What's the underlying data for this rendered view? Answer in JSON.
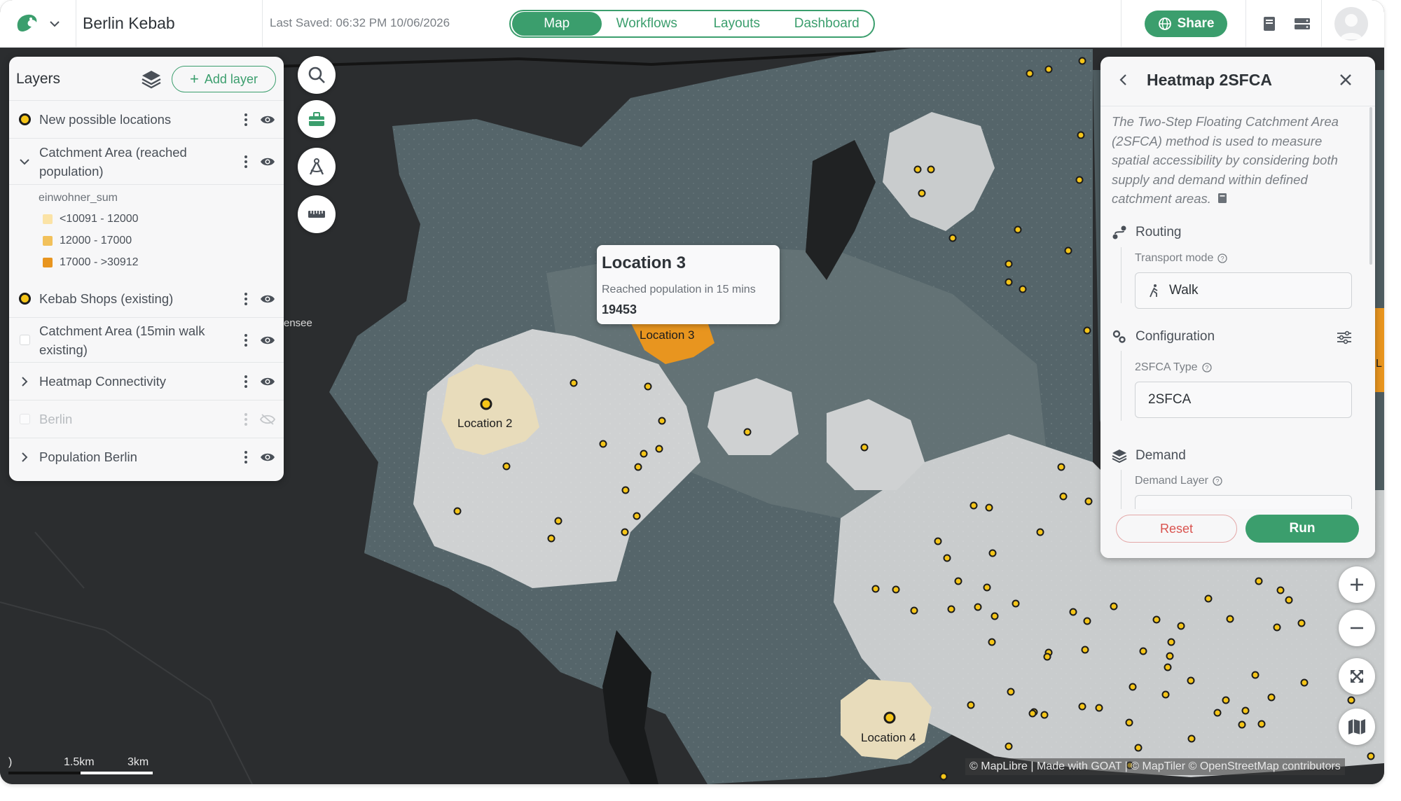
{
  "header": {
    "project_title": "Berlin Kebab",
    "last_saved": "Last Saved: 06:32 PM 10/06/2026",
    "tabs": [
      {
        "label": "Map",
        "active": true
      },
      {
        "label": "Workflows",
        "active": false
      },
      {
        "label": "Layouts",
        "active": false
      },
      {
        "label": "Dashboard",
        "active": false
      }
    ],
    "share_label": "Share",
    "accent_color": "#3b9e6d"
  },
  "layers_panel": {
    "title": "Layers",
    "add_layer_label": "Add layer",
    "layers": [
      {
        "name": "New possible locations",
        "marker": "yellow-dot",
        "visible": true
      },
      {
        "name": "Catchment Area (reached population)",
        "marker": "chevron-down",
        "visible": true
      },
      {
        "name": "Kebab Shops (existing)",
        "marker": "yellow-dot",
        "visible": true
      },
      {
        "name": "Catchment Area (15min walk existing)",
        "marker": "white-square",
        "visible": true
      },
      {
        "name": "Heatmap Connectivity",
        "marker": "chevron-right",
        "visible": true
      },
      {
        "name": "Berlin",
        "marker": "white-square",
        "visible": false
      },
      {
        "name": "Population Berlin",
        "marker": "chevron-right",
        "visible": true
      }
    ],
    "legend": {
      "field": "einwohner_sum",
      "classes": [
        {
          "label": "<10091 - 12000",
          "color": "#fbe3a6"
        },
        {
          "label": "12000 - 17000",
          "color": "#f2c15b"
        },
        {
          "label": "17000 - >30912",
          "color": "#e8951f"
        }
      ]
    }
  },
  "map": {
    "labels": [
      "Location 2",
      "Location 3",
      "Location 4"
    ],
    "edge_label_left": "ensee",
    "edge_label_right": "L",
    "attribution": "© MapLibre | Made with GOAT | © MapTiler © OpenStreetMap contributors",
    "scale": {
      "left": ")",
      "mid": "1.5km",
      "right": "3km"
    }
  },
  "popup": {
    "title": "Location 3",
    "subtitle": "Reached population in 15 mins",
    "value": "19453"
  },
  "tool_panel": {
    "title": "Heatmap 2SFCA",
    "description": "The Two-Step Floating Catchment Area (2SFCA) method is used to measure spatial accessibility by considering both supply and demand within defined catchment areas.",
    "routing": {
      "section": "Routing",
      "label": "Transport mode",
      "value": "Walk"
    },
    "configuration": {
      "section": "Configuration",
      "label": "2SFCA Type",
      "value": "2SFCA"
    },
    "demand": {
      "section": "Demand",
      "label": "Demand Layer"
    },
    "reset_label": "Reset",
    "run_label": "Run"
  }
}
